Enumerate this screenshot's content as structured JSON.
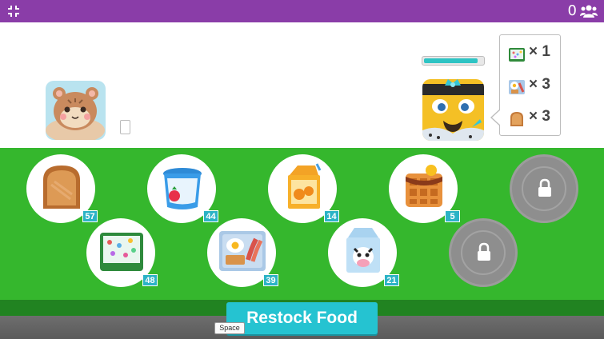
{
  "topbar": {
    "player_count": "0",
    "collapse_icon": "collapse-icon",
    "players_icon": "players-icon",
    "color": "#8a3da8"
  },
  "customer": {
    "health_fraction": 0.92
  },
  "order": [
    {
      "icon": "cereal-icon",
      "qty": "× 1"
    },
    {
      "icon": "breakfast-plate-icon",
      "qty": "× 3"
    },
    {
      "icon": "toast-icon",
      "qty": "× 3"
    }
  ],
  "foods": [
    {
      "name": "toast",
      "count": "57"
    },
    {
      "name": "yogurt",
      "count": "44"
    },
    {
      "name": "orange-juice",
      "count": "14"
    },
    {
      "name": "waffle",
      "count": "5"
    },
    {
      "name": "cereal",
      "count": "48"
    },
    {
      "name": "breakfast-plate",
      "count": "39"
    },
    {
      "name": "milk",
      "count": "21"
    }
  ],
  "locked_slots": 2,
  "restock": {
    "label": "Restock Food",
    "key_hint": "Space"
  },
  "colors": {
    "field": "#35b72d",
    "button": "#25c3d1",
    "badge": "#2bb3c6"
  }
}
